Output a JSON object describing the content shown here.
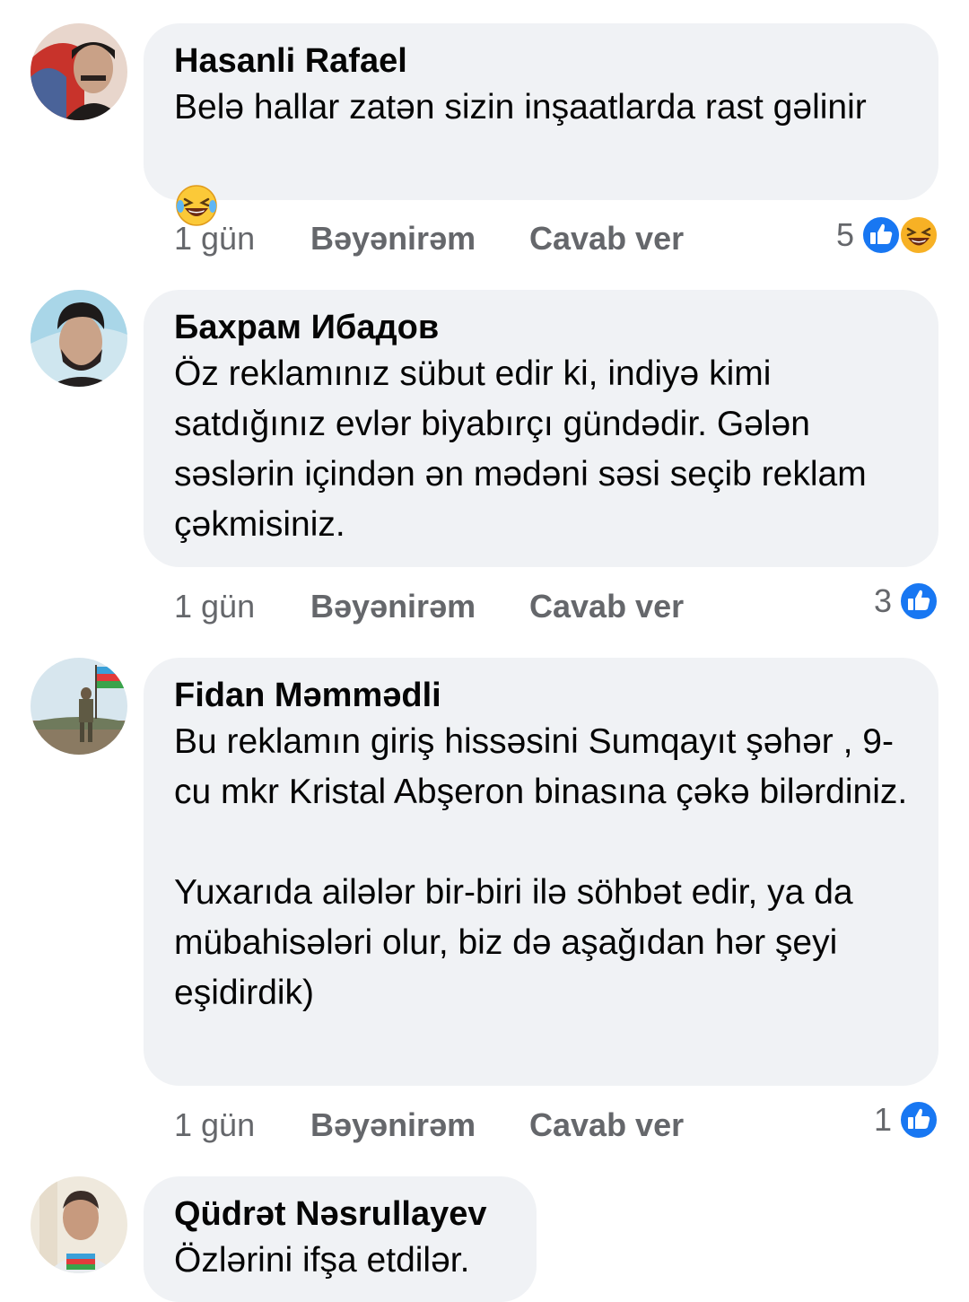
{
  "comments": [
    {
      "author": "Hasanli Rafael",
      "text": "Belə hallar zatən sizin inşaatlarda rast gəlinir",
      "text_emoji": "laughing-tears-emoji",
      "time": "1 gün",
      "like_label": "Bəyənirəm",
      "reply_label": "Cavab ver",
      "reaction_count": "5",
      "reactions": [
        "like-reaction-icon",
        "haha-reaction-icon"
      ]
    },
    {
      "author": "Бахрам Ибадов",
      "text": "Öz reklamınız sübut edir ki, indiyə kimi satdığınız evlər biyabırçı gündədir. Gələn səslərin içindən ən mədəni səsi seçib reklam çəkmisiniz.",
      "time": "1 gün",
      "like_label": "Bəyənirəm",
      "reply_label": "Cavab ver",
      "reaction_count": "3",
      "reactions": [
        "like-reaction-icon"
      ]
    },
    {
      "author": "Fidan Məmmədli",
      "text": "Bu reklamın giriş hissəsini Sumqayıt şəhər , 9-cu mkr Kristal Abşeron binasına çəkə bilərdiniz.\n\nYuxarıda ailələr bir-biri ilə söhbət edir, ya da mübahisələri olur, biz də aşağıdan hər şeyi eşidirdik)",
      "time": "1 gün",
      "like_label": "Bəyənirəm",
      "reply_label": "Cavab ver",
      "reaction_count": "1",
      "reactions": [
        "like-reaction-icon"
      ]
    },
    {
      "author": "Qüdrət Nəsrullayev",
      "text": "Özlərini ifşa etdilər."
    }
  ],
  "colors": {
    "bubble": "#f0f2f5",
    "meta_text": "#65676b",
    "like_blue": "#1877f2",
    "haha_yellow": "#f7b125"
  }
}
